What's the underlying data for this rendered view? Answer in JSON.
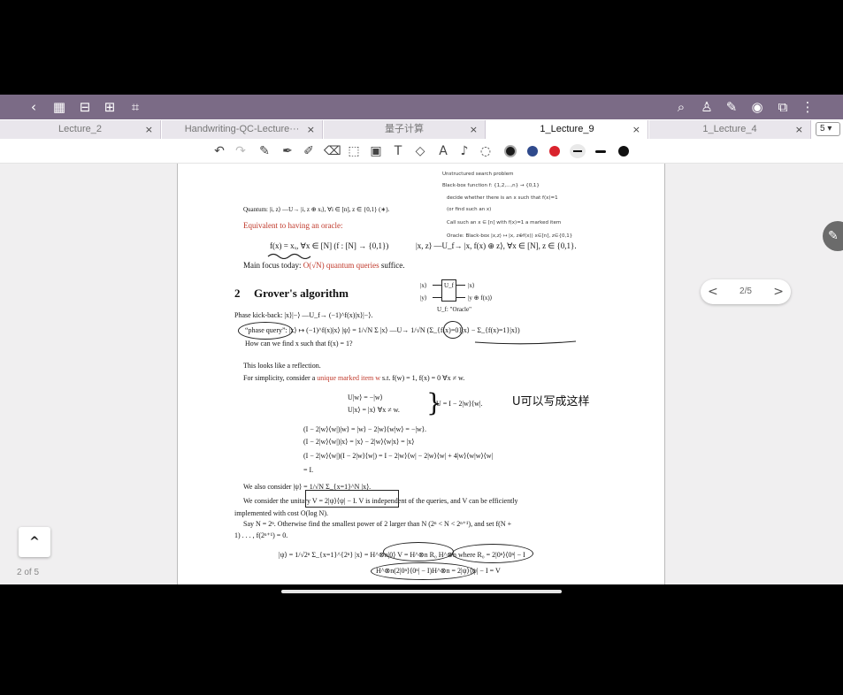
{
  "topbar": {
    "left_icons": [
      "back-icon",
      "grid-icon",
      "bookmark-icon",
      "add-page-icon",
      "crop-icon"
    ],
    "right_icons": [
      "search-icon",
      "shirt-icon",
      "pen-icon",
      "eye-icon",
      "copy-icon",
      "more-icon"
    ]
  },
  "tabs": [
    {
      "label": "Lecture_2",
      "close": "×"
    },
    {
      "label": "Handwriting-QC-Lecture···",
      "close": "×"
    },
    {
      "label": "量子计算",
      "close": "×"
    },
    {
      "label": "1_Lecture_9",
      "close": "×",
      "active": true
    },
    {
      "label": "1_Lecture_4",
      "close": "×"
    }
  ],
  "tab_count": "5 ▾",
  "toolbar": {
    "tools": [
      "undo-icon",
      "redo-icon",
      "pen-icon",
      "highlighter-icon",
      "marker-icon",
      "eraser-icon",
      "lasso-icon",
      "image-icon",
      "text-icon",
      "shape-icon",
      "ocr-icon",
      "mic-icon",
      "sticker-icon"
    ],
    "colors": [
      "#1a1a1a",
      "#2f4a8c",
      "#d9232d"
    ],
    "active_color": "#1a1a1a"
  },
  "doc": {
    "hw_top": [
      "Unstructured search problem",
      "Black-box function  f: {1,2,...,n} → {0,1}",
      "decide whether there is an x such that  f(x)=1",
      "(or find such an x)",
      "Call such an x ∈ [n] with f(x)=1 a marked item",
      "Oracle: Black-box  |x,z⟩ ↦ |x, z⊕f(x)⟩   x∈[n], z∈{0,1}"
    ],
    "quantum_line": "Quantum: |i, z⟩ —U→ |i, z ⊕ xᵢ⟩,  ∀i ∈ [n], z ∈ {0,1} (∗).",
    "equiv_oracle": "Equivalent to having an oracle:",
    "f_def": "f(x) = xₓ, ∀x ∈ [N] (f : [N] → {0,1})",
    "oracle_map": "|x, z⟩ —U_f→ |x, f(x) ⊕ z⟩,   ∀x ∈ [N], z ∈ {0,1}.",
    "main_focus_pre": "Main focus today: ",
    "main_focus_red": "O(√N) quantum queries",
    "main_focus_post": " suffice.",
    "circuit_in1": "|x⟩",
    "circuit_in2": "|y⟩",
    "circuit_gate": "U_f",
    "circuit_out1": "|x⟩",
    "circuit_out2": "|y ⊕ f(x)⟩",
    "circuit_caption": "U_f: \"Oracle\"",
    "sec_num": "2",
    "sec_title": "Grover's algorithm",
    "phase_kickback": "Phase kick-back: |x⟩|−⟩ —U_f→ (−1)^f(x)|x⟩|−⟩.",
    "phase_query": "“phase query”: |x⟩ ↦ (−1)^f(x)|x⟩    |ψ⟩ = 1/√N Σ |x⟩  —U→  1/√N (Σ_{f(x)=0}|x⟩ − Σ_{f(x)=1}|x⟩)",
    "find_x": "How can we find x such that f(x) = 1?",
    "reflection": "This looks like a reflection.",
    "simplicity_pre": "For simplicity, consider a ",
    "simplicity_red": "unique marked item w",
    "simplicity_post": "  s.t.  f(w) = 1,   f(x) = 0  ∀x ≠ w.",
    "uw": "U|w⟩ = −|w⟩",
    "ux": "U|x⟩ = |x⟩   ∀x ≠ w.",
    "u_def": "U = I − 2|w⟩⟨w|.",
    "hw_note": "U可以写成这样",
    "eq1": "(I − 2|w⟩⟨w|)|w⟩ = |w⟩ − 2|w⟩⟨w|w⟩ = −|w⟩.",
    "eq2": "(I − 2|w⟩⟨w|)|x⟩ = |x⟩ − 2|w⟩⟨w|x⟩ = |x⟩",
    "eq3": "(I − 2|w⟩⟨w|)(I − 2|w⟩⟨w|) = I − 2|w⟩⟨w| − 2|w⟩⟨w| + 4|w⟩⟨w|w⟩⟨w|",
    "eq4": "= I.",
    "also_consider": "We also consider |ψ⟩ = 1/√N Σ_{x=1}^N |x⟩.",
    "unitary_line": "We consider the unitary V = 2|ψ⟩⟨ψ| − I.   V is independent of the queries, and V can be efficiently",
    "implemented": "implemented with cost O(log N).",
    "say_line": "Say N = 2ⁿ. Otherwise find the smallest power of 2 larger than N (2ⁿ < N < 2ⁿ⁺¹), and set f(N +",
    "say_line2": "1) . . . , f(2ⁿ⁺¹) = 0.",
    "bottom_eq": "|ψ⟩ = 1/√2ⁿ Σ_{x=1}^{2ⁿ} |x⟩ = H^⊗n|0⟩   V = H^⊗n R₀ H^⊗n  where  R₀ = 2|0ⁿ⟩⟨0ⁿ| − I",
    "bottom_eq2": "H^⊗n(2|0ⁿ⟩⟨0ⁿ| − I)H^⊗n  =  2|ψ⟩⟨ψ| − I = V"
  },
  "pager": {
    "label": "2/5",
    "prev": "<",
    "next": ">"
  },
  "page_indicator": "2 of 5",
  "up_button": "^"
}
